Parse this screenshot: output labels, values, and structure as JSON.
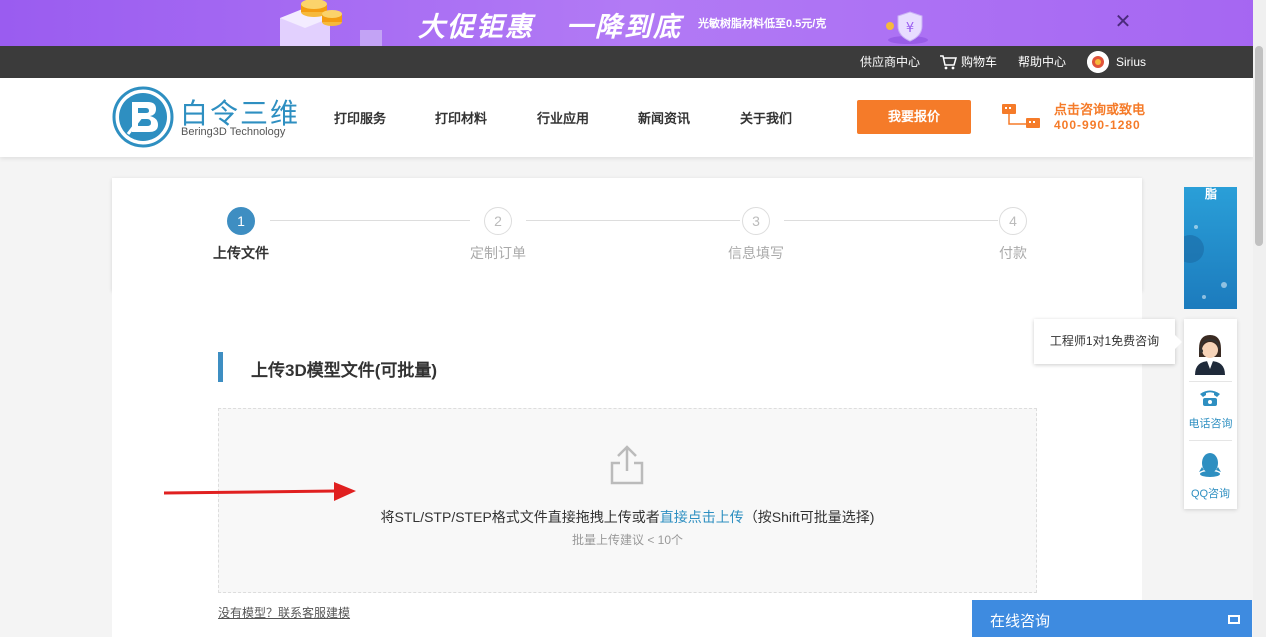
{
  "banner": {
    "headline_1": "大促钜惠",
    "headline_2": "一降到底",
    "subtext": "光敏树脂材料低至0.5元/克",
    "close_glyph": "✕",
    "shield_glyph": "¥"
  },
  "topbar": {
    "supplier_center": "供应商中心",
    "cart": "购物车",
    "help_center": "帮助中心",
    "username": "Sirius"
  },
  "header": {
    "logo_title": "白令三维",
    "logo_subtitle": "Bering3D Technology",
    "nav": [
      "打印服务",
      "打印材料",
      "行业应用",
      "新闻资讯",
      "关于我们"
    ],
    "quote_button": "我要报价",
    "contact_title": "点击咨询或致电",
    "contact_phone": "400-990-1280"
  },
  "steps": [
    {
      "num": "1",
      "label": "上传文件",
      "active": true
    },
    {
      "num": "2",
      "label": "定制订单",
      "active": false
    },
    {
      "num": "3",
      "label": "信息填写",
      "active": false
    },
    {
      "num": "4",
      "label": "付款",
      "active": false
    }
  ],
  "upload": {
    "section_title": "上传3D模型文件(可批量)",
    "main_text_prefix": "将STL/STP/STEP格式文件直接拖拽上传或者",
    "main_text_link": "直接点击上传",
    "main_text_suffix": "（按Shift可批量选择)",
    "sub_text": "批量上传建议 < 10个",
    "no_model_link": "没有模型？联系客服建模"
  },
  "side_panel": {
    "ad_text": "脂",
    "tooltip": "工程师1对1免费咨询",
    "phone_label": "电话咨询",
    "qq_label": "QQ咨询"
  },
  "chat": {
    "label": "在线咨询"
  },
  "colors": {
    "accent_blue": "#3e8ec2",
    "orange": "#f57b29",
    "banner_purple": "#a566f2",
    "arrow_red": "#e02020"
  }
}
